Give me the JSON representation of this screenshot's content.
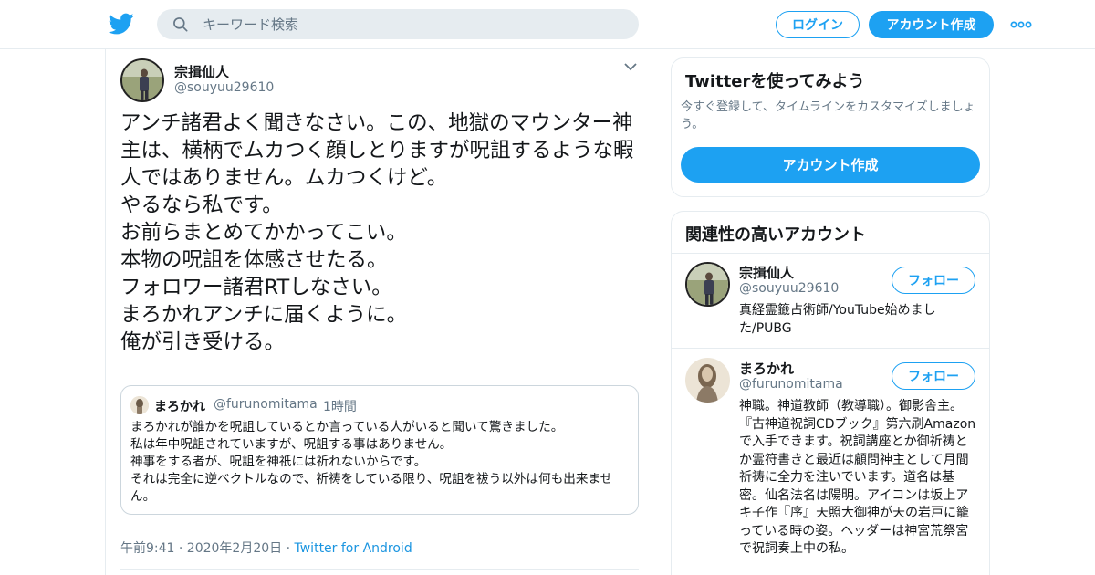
{
  "header": {
    "search_placeholder": "キーワード検索",
    "login_label": "ログイン",
    "signup_label": "アカウント作成",
    "accent_color": "#1da1f2"
  },
  "tweet": {
    "display_name": "宗揖仙人",
    "handle": "@souyuu29610",
    "text": "アンチ諸君よく聞きなさい。この、地獄のマウンター神主は、横柄でムカつく顔しとりますが呪詛するような暇人ではありません。ムカつくけど。\nやるなら私です。\nお前らまとめてかかってこい。\n本物の呪詛を体感させたる。\nフォロワー諸君RTしなさい。\nまろかれアンチに届くように。\n俺が引き受ける。",
    "timestamp": "午前9:41 · 2020年2月20日",
    "separator": "·",
    "source": "Twitter for Android",
    "quote": {
      "display_name": "まろかれ",
      "handle": "@furunomitama",
      "dot": "·",
      "time": "1時間",
      "text": "まろかれが誰かを呪詛しているとか言っている人がいると聞いて驚きました。\n私は年中呪詛されていますが、呪詛する事はありません。\n神事をする者が、呪詛を神祇には祈れないからです。\nそれは完全に逆ベクトルなので、祈祷をしている限り、呪詛を祓う以外は何も出来ません。"
    }
  },
  "sidebar": {
    "signup_card": {
      "title": "Twitterを使ってみよう",
      "subtitle": "今すぐ登録して、タイムラインをカスタマイズしましょう。",
      "button_label": "アカウント作成"
    },
    "related": {
      "title": "関連性の高いアカウント",
      "accounts": [
        {
          "name": "宗揖仙人",
          "handle": "@souyuu29610",
          "follow_label": "フォロー",
          "bio": "真経霊籤占術師/YouTube始めました/PUBG"
        },
        {
          "name": "まろかれ",
          "handle": "@furunomitama",
          "follow_label": "フォロー",
          "bio": "神職。神道教師（教導職）。御影舎主。『古神道祝詞CDブック』第六刷Amazonで入手できます。祝詞講座とか御祈祷とか霊符書きと最近は顧問神主として月間祈祷に全力を注いでいます。道名は基密。仙名法名は陽明。アイコンは坂上アキ子作『序』天照大御神が天の岩戸に籠っている時の姿。ヘッダーは神宮荒祭宮で祝詞奏上中の私。"
        }
      ]
    }
  }
}
